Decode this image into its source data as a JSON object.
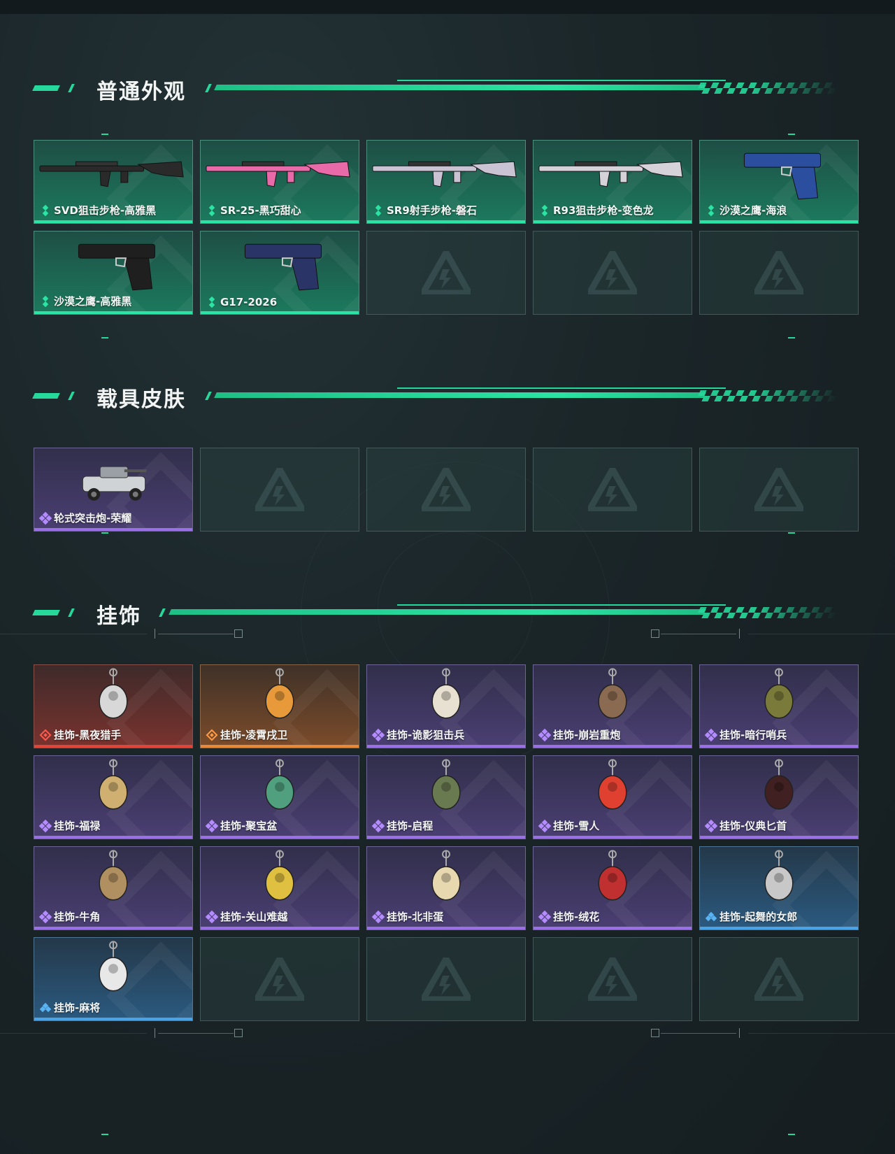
{
  "theme": {
    "accent": "#26d99a",
    "rarity_green": "#2be3a3",
    "rarity_purple": "#9a70e6",
    "rarity_red": "#e0453a",
    "rarity_orange": "#e68a3a",
    "rarity_blue": "#4aa3e6"
  },
  "sections": [
    {
      "title": "普通外观",
      "items": [
        {
          "label": "SVD狙击步枪-高雅黑",
          "rarity": "green",
          "icon": "rifle-icon"
        },
        {
          "label": "SR-25-黑巧甜心",
          "rarity": "green",
          "icon": "rifle-icon"
        },
        {
          "label": "SR9射手步枪-磐石",
          "rarity": "green",
          "icon": "rifle-icon"
        },
        {
          "label": "R93狙击步枪-变色龙",
          "rarity": "green",
          "icon": "rifle-icon"
        },
        {
          "label": "沙漠之鹰-海浪",
          "rarity": "green",
          "icon": "pistol-icon"
        },
        {
          "label": "沙漠之鹰-高雅黑",
          "rarity": "green",
          "icon": "pistol-icon"
        },
        {
          "label": "G17-2026",
          "rarity": "green",
          "icon": "pistol-icon"
        }
      ],
      "empty_slots": 3
    },
    {
      "title": "载具皮肤",
      "items": [
        {
          "label": "轮式突击炮-荣耀",
          "rarity": "purple",
          "icon": "vehicle-icon"
        }
      ],
      "empty_slots": 4
    },
    {
      "title": "挂饰",
      "items": [
        {
          "label": "挂饰-黑夜猎手",
          "rarity": "red",
          "icon": "charm-icon"
        },
        {
          "label": "挂饰-凌霄戌卫",
          "rarity": "orange",
          "icon": "charm-icon"
        },
        {
          "label": "挂饰-诡影狙击兵",
          "rarity": "purple",
          "icon": "charm-icon"
        },
        {
          "label": "挂饰-崩岩重炮",
          "rarity": "purple",
          "icon": "charm-icon"
        },
        {
          "label": "挂饰-暗行哨兵",
          "rarity": "purple",
          "icon": "charm-icon"
        },
        {
          "label": "挂饰-福禄",
          "rarity": "purple",
          "icon": "charm-icon"
        },
        {
          "label": "挂饰-聚宝盆",
          "rarity": "purple",
          "icon": "charm-icon"
        },
        {
          "label": "挂饰-启程",
          "rarity": "purple",
          "icon": "charm-icon"
        },
        {
          "label": "挂饰-雪人",
          "rarity": "purple",
          "icon": "charm-icon"
        },
        {
          "label": "挂饰-仪典匕首",
          "rarity": "purple",
          "icon": "charm-icon"
        },
        {
          "label": "挂饰-牛角",
          "rarity": "purple",
          "icon": "charm-icon"
        },
        {
          "label": "挂饰-关山难越",
          "rarity": "purple",
          "icon": "charm-icon"
        },
        {
          "label": "挂饰-北非蛋",
          "rarity": "purple",
          "icon": "charm-icon"
        },
        {
          "label": "挂饰-绒花",
          "rarity": "purple",
          "icon": "charm-icon"
        },
        {
          "label": "挂饰-起舞的女郎",
          "rarity": "blue",
          "icon": "charm-icon"
        },
        {
          "label": "挂饰-麻将",
          "rarity": "blue",
          "icon": "charm-icon"
        }
      ],
      "empty_slots": 4
    }
  ]
}
